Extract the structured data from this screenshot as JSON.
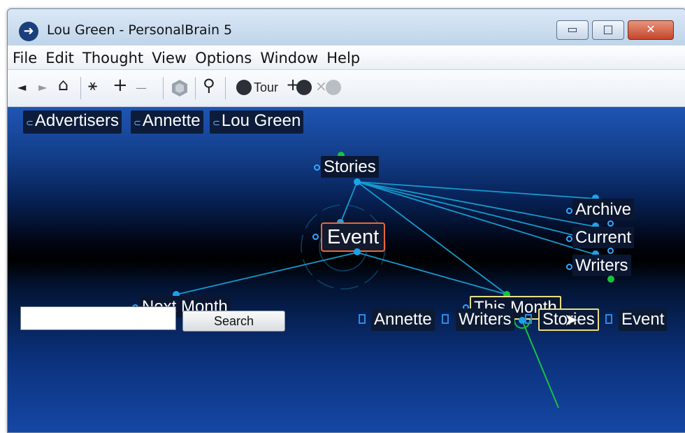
{
  "window": {
    "title": "Lou Green - PersonalBrain 5",
    "controls": {
      "minimize": "▭",
      "maximize": "□",
      "close": "✕"
    }
  },
  "menu": [
    "File",
    "Edit",
    "Thought",
    "View",
    "Options",
    "Window",
    "Help"
  ],
  "toolbar": {
    "back": "◄",
    "forward": "►",
    "home": "⌂",
    "link": "⚹",
    "add": "+",
    "remove": "—",
    "search": "⚲",
    "tour_label": "Tour",
    "tour_add": "+",
    "tour_remove": "×"
  },
  "pins": [
    "Advertisers",
    "Annette",
    "Lou Green"
  ],
  "plex": {
    "active": "Event",
    "parent": "Stories",
    "children": [
      "Archive",
      "Current",
      "Writers"
    ],
    "jumps": [
      "Next Month"
    ],
    "selected": "This Month"
  },
  "search": {
    "value": "",
    "button_label": "Search"
  },
  "bottom_bar": [
    "Annette",
    "Writers",
    "Stories",
    "Event"
  ],
  "colors": {
    "active_border": "#e4693a",
    "selected_border": "#e6de88",
    "link": "#1aa3ea",
    "parent_link": "#19c23d"
  }
}
